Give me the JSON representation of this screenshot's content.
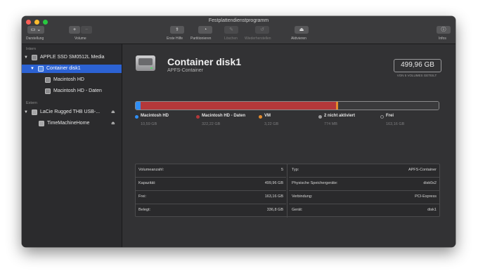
{
  "window": {
    "title": "Festplattendienstprogramm"
  },
  "toolbar": {
    "darstellung": "Darstellung",
    "volume": "Volume",
    "plus": "+",
    "minus": "−",
    "erste_hilfe": "Erste Hilfe",
    "partitionieren": "Partitionieren",
    "loeschen": "Löschen",
    "wiederherstellen": "Wiederherstellen",
    "aktivieren": "Aktivieren",
    "infos": "Infos"
  },
  "sidebar": {
    "intern": "Intern",
    "extern": "Extern",
    "items": [
      {
        "label": "APPLE SSD SM0512L Media"
      },
      {
        "label": "Container disk1"
      },
      {
        "label": "Macintosh HD"
      },
      {
        "label": "Macintosh HD - Daten"
      },
      {
        "label": "LaCie Rugged THB USB-..."
      },
      {
        "label": "TimeMachineHome"
      }
    ],
    "eject_icon": "eject-icon"
  },
  "detail": {
    "title": "Container disk1",
    "subtitle": "APFS-Container",
    "capacity": "499,96 GB",
    "capacity_sub": "VON 5 VOLUMES GETEILT"
  },
  "usage": {
    "segments": [
      {
        "name": "Macintosh HD",
        "size": "10,59 GB",
        "color": "#2f8ef5",
        "fraction": 0.0165
      },
      {
        "name": "Macintosh HD - Daten",
        "size": "322,22 GB",
        "color": "#b4383a",
        "fraction": 0.6445
      },
      {
        "name": "VM",
        "size": "3,22 GB",
        "color": "#e38a2c",
        "fraction": 0.0064
      },
      {
        "name": "2 nicht aktiviert",
        "size": "774 MB",
        "color": "#9c9c9e",
        "fraction": 0.0015
      },
      {
        "name": "Frei",
        "size": "163,16 GB",
        "color": "#3a3a3c",
        "fraction": 0.3311
      }
    ]
  },
  "info": {
    "left": [
      {
        "key": "Volumeanzahl:",
        "value": "5"
      },
      {
        "key": "Kapazität:",
        "value": "499,96 GB"
      },
      {
        "key": "Frei:",
        "value": "163,16 GB"
      },
      {
        "key": "Belegt:",
        "value": "336,8 GB"
      }
    ],
    "right": [
      {
        "key": "Typ:",
        "value": "APFS-Container"
      },
      {
        "key": "Physische Speichergeräte:",
        "value": "disk0s2"
      },
      {
        "key": "Verbindung:",
        "value": "PCI-Express"
      },
      {
        "key": "Gerät:",
        "value": "disk1"
      }
    ]
  }
}
